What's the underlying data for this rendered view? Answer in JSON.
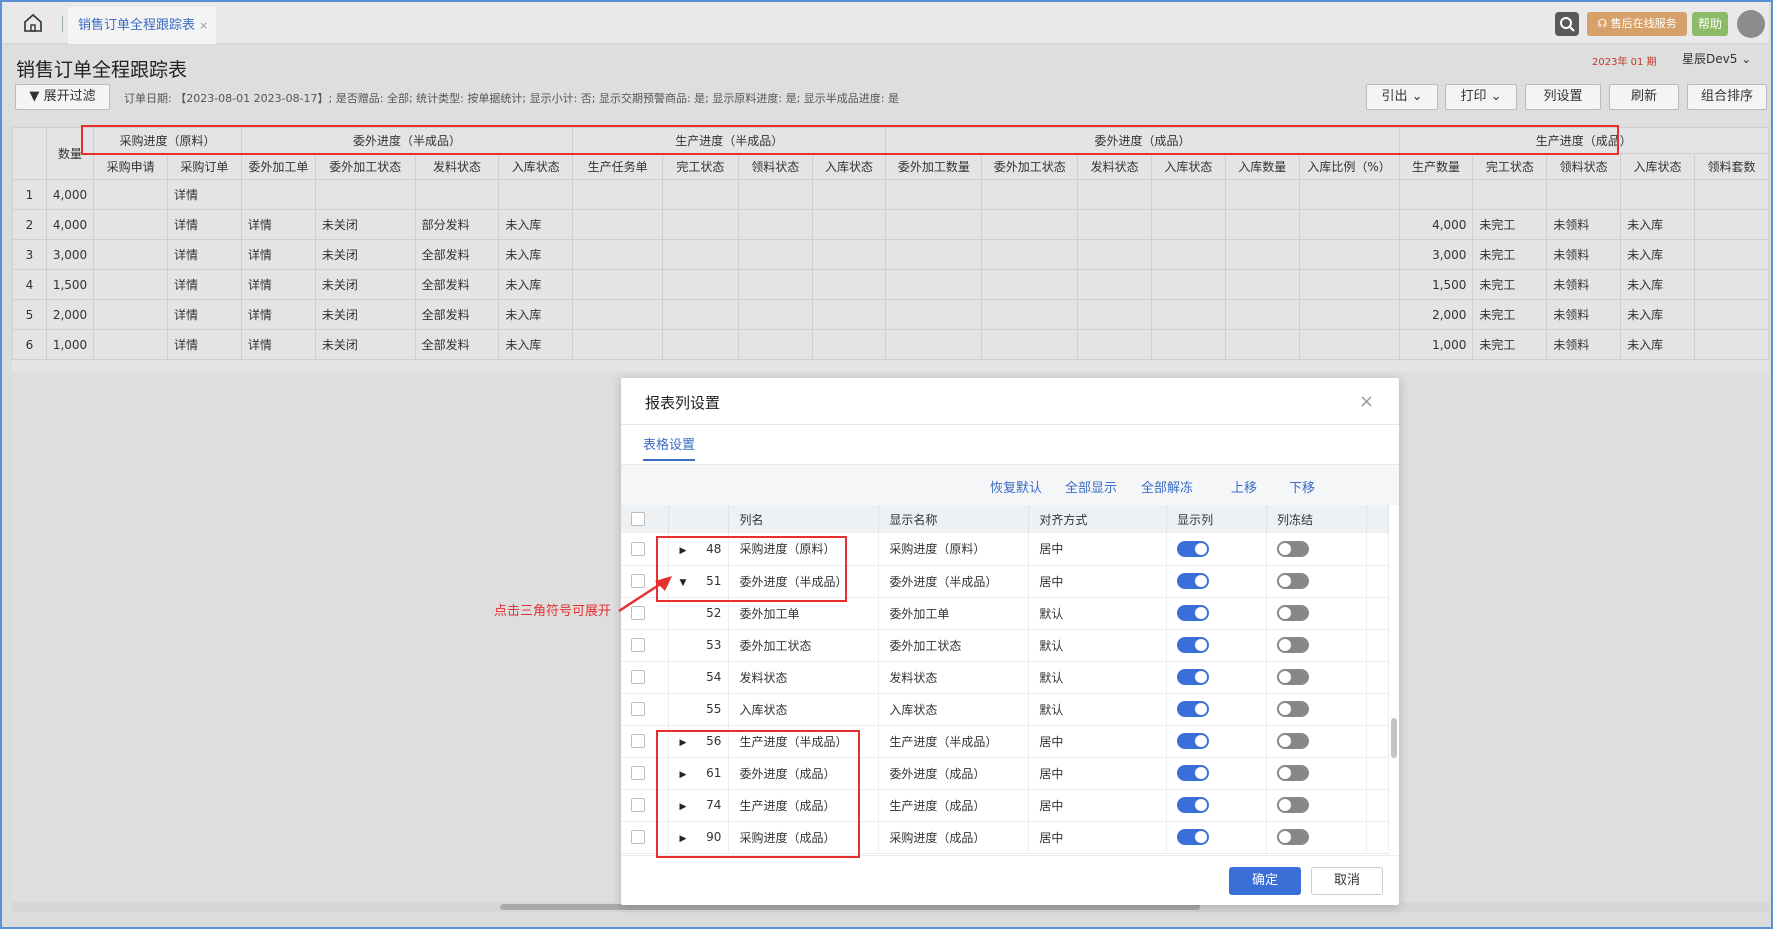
{
  "tabbar": {
    "tab_label": "销售订单全程跟踪表",
    "tab_close": "×"
  },
  "toolbar": {
    "service_label": "售后在线服务",
    "help_label": "帮助"
  },
  "header": {
    "page_title": "销售订单全程跟踪表",
    "date_badge": "2023年 01 期",
    "user_name": "星辰Dev5",
    "filter_button": "展开过滤",
    "filter_info": "订单日期: 【2023-08-01 2023-08-17】; 是否赠品: 全部; 统计类型: 按单据统计; 显示小计: 否; 显示交期预警商品: 是; 显示原料进度: 是; 显示半成品进度: 是",
    "buttons": {
      "export": "引出",
      "print": "打印",
      "column_settings": "列设置",
      "refresh": "刷新",
      "combo_sort": "组合排序"
    }
  },
  "grid": {
    "qty_header": "数量",
    "group_headers": [
      "采购进度（原料）",
      "委外进度（半成品）",
      "生产进度（半成品）",
      "委外进度（成品）",
      "生产进度（成品）"
    ],
    "sub_headers": [
      "采购申请",
      "采购订单",
      "委外加工单",
      "委外加工状态",
      "发料状态",
      "入库状态",
      "生产任务单",
      "完工状态",
      "领料状态",
      "入库状态",
      "委外加工数量",
      "委外加工状态",
      "发料状态",
      "入库状态",
      "入库数量",
      "入库比例（%）",
      "生产数量",
      "完工状态",
      "领料状态",
      "入库状态",
      "领料套数"
    ],
    "rows": [
      {
        "idx": "1",
        "qty": "4,000",
        "po": "详情",
        "wo": "",
        "wo_status": "",
        "issue": "",
        "in": "",
        "prod_qty": "",
        "done": "",
        "pick": "",
        "stock": ""
      },
      {
        "idx": "2",
        "qty": "4,000",
        "po": "详情",
        "wo": "详情",
        "wo_status": "未关闭",
        "issue": "部分发料",
        "in": "未入库",
        "prod_qty": "4,000",
        "done": "未完工",
        "pick": "未领料",
        "stock": "未入库"
      },
      {
        "idx": "3",
        "qty": "3,000",
        "po": "详情",
        "wo": "详情",
        "wo_status": "未关闭",
        "issue": "全部发料",
        "in": "未入库",
        "prod_qty": "3,000",
        "done": "未完工",
        "pick": "未领料",
        "stock": "未入库"
      },
      {
        "idx": "4",
        "qty": "1,500",
        "po": "详情",
        "wo": "详情",
        "wo_status": "未关闭",
        "issue": "全部发料",
        "in": "未入库",
        "prod_qty": "1,500",
        "done": "未完工",
        "pick": "未领料",
        "stock": "未入库"
      },
      {
        "idx": "5",
        "qty": "2,000",
        "po": "详情",
        "wo": "详情",
        "wo_status": "未关闭",
        "issue": "全部发料",
        "in": "未入库",
        "prod_qty": "2,000",
        "done": "未完工",
        "pick": "未领料",
        "stock": "未入库"
      },
      {
        "idx": "6",
        "qty": "1,000",
        "po": "详情",
        "wo": "详情",
        "wo_status": "未关闭",
        "issue": "全部发料",
        "in": "未入库",
        "prod_qty": "1,000",
        "done": "未完工",
        "pick": "未领料",
        "stock": "未入库"
      }
    ]
  },
  "annotation": {
    "hint": "点击三角符号可展开"
  },
  "modal": {
    "title": "报表列设置",
    "close": "×",
    "tab": "表格设置",
    "actions": [
      "恢复默认",
      "全部显示",
      "全部解冻",
      "上移",
      "下移"
    ],
    "columns": {
      "name": "列名",
      "display": "显示名称",
      "align": "对齐方式",
      "show": "显示列",
      "freeze": "列冻结"
    },
    "rows": [
      {
        "tri": "▶",
        "num": "48",
        "name": "采购进度（原料）",
        "display": "采购进度（原料）",
        "align": "居中",
        "show": true,
        "freeze": false
      },
      {
        "tri": "▼",
        "num": "51",
        "name": "委外进度（半成品）",
        "display": "委外进度（半成品）",
        "align": "居中",
        "show": true,
        "freeze": false
      },
      {
        "tri": "",
        "num": "52",
        "name": "委外加工单",
        "display": "委外加工单",
        "align": "默认",
        "show": true,
        "freeze": false
      },
      {
        "tri": "",
        "num": "53",
        "name": "委外加工状态",
        "display": "委外加工状态",
        "align": "默认",
        "show": true,
        "freeze": false
      },
      {
        "tri": "",
        "num": "54",
        "name": "发料状态",
        "display": "发料状态",
        "align": "默认",
        "show": true,
        "freeze": false
      },
      {
        "tri": "",
        "num": "55",
        "name": "入库状态",
        "display": "入库状态",
        "align": "默认",
        "show": true,
        "freeze": false
      },
      {
        "tri": "▶",
        "num": "56",
        "name": "生产进度（半成品）",
        "display": "生产进度（半成品）",
        "align": "居中",
        "show": true,
        "freeze": false
      },
      {
        "tri": "▶",
        "num": "61",
        "name": "委外进度（成品）",
        "display": "委外进度（成品）",
        "align": "居中",
        "show": true,
        "freeze": false
      },
      {
        "tri": "▶",
        "num": "74",
        "name": "生产进度（成品）",
        "display": "生产进度（成品）",
        "align": "居中",
        "show": true,
        "freeze": false
      },
      {
        "tri": "▶",
        "num": "90",
        "name": "采购进度（成品）",
        "display": "采购进度（成品）",
        "align": "居中",
        "show": true,
        "freeze": false
      }
    ],
    "ok": "确定",
    "cancel": "取消"
  }
}
